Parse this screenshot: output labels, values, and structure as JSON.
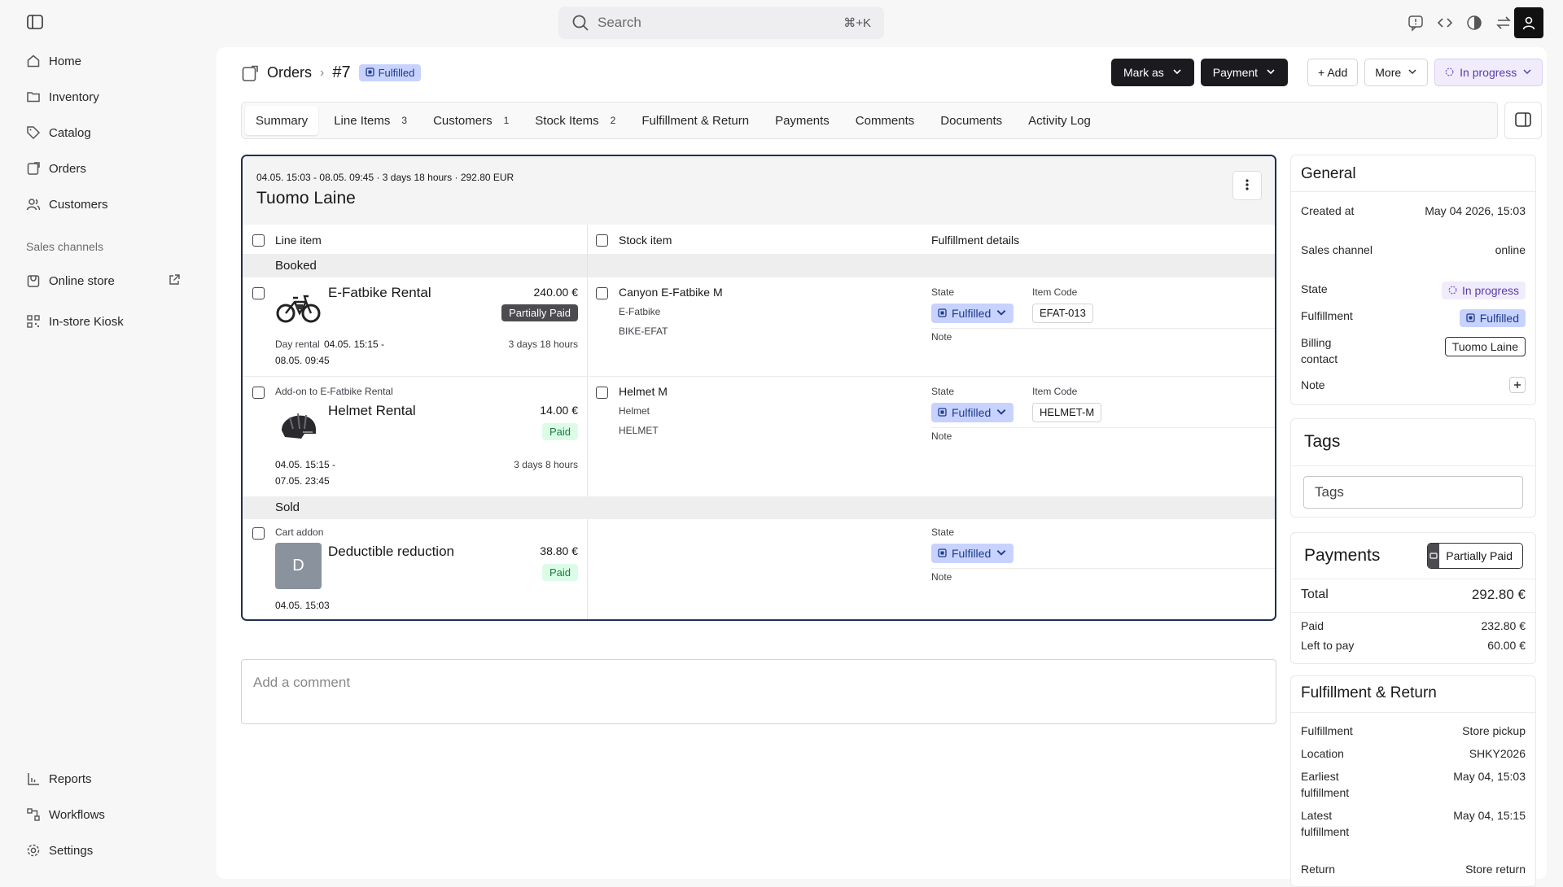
{
  "topbar": {
    "search_placeholder": "Search",
    "search_shortcut": "⌘+K"
  },
  "sidebar": {
    "items": [
      {
        "label": "Home",
        "icon": "home-icon"
      },
      {
        "label": "Inventory",
        "icon": "folder-icon"
      },
      {
        "label": "Catalog",
        "icon": "tag-icon"
      },
      {
        "label": "Orders",
        "icon": "orders-icon"
      },
      {
        "label": "Customers",
        "icon": "users-icon"
      }
    ],
    "channels_heading": "Sales channels",
    "channels": [
      {
        "label": "Online store"
      },
      {
        "label": "In-store Kiosk"
      }
    ],
    "bottom": [
      {
        "label": "Reports"
      },
      {
        "label": "Workflows"
      },
      {
        "label": "Settings"
      }
    ]
  },
  "header": {
    "breadcrumb": "Orders",
    "order_number": "#7",
    "status_badge": "Fulfilled",
    "mark_as": "Mark as",
    "payment": "Payment",
    "add": "+ Add",
    "more": "More",
    "progress": "In progress"
  },
  "tabs": [
    {
      "label": "Summary",
      "count": ""
    },
    {
      "label": "Line Items",
      "count": "3"
    },
    {
      "label": "Customers",
      "count": "1"
    },
    {
      "label": "Stock Items",
      "count": "2"
    },
    {
      "label": "Fulfillment & Return",
      "count": ""
    },
    {
      "label": "Payments",
      "count": ""
    },
    {
      "label": "Comments",
      "count": ""
    },
    {
      "label": "Documents",
      "count": ""
    },
    {
      "label": "Activity Log",
      "count": ""
    }
  ],
  "order": {
    "meta": "04.05. 15:03 - 08.05. 09:45 · 3 days 18 hours · 292.80 EUR",
    "customer": "Tuomo Laine",
    "col_line_item": "Line item",
    "col_stock_item": "Stock item",
    "col_fulfillment": "Fulfillment details",
    "sec_booked": "Booked",
    "sec_sold": "Sold",
    "state_label": "State",
    "item_code_label": "Item Code",
    "note_label": "Note",
    "rows": [
      {
        "name": "E-Fatbike Rental",
        "price": "240.00 €",
        "pay": "Partially Paid",
        "date_prefix": "Day rental",
        "date1": "04.05. 15:15 -",
        "date2": "08.05. 09:45",
        "duration": "3 days 18 hours",
        "stock_name": "Canyon E-Fatbike M",
        "stock_type": "E-Fatbike",
        "stock_sku": "BIKE-EFAT",
        "state": "Fulfilled",
        "code": "EFAT-013"
      },
      {
        "parent": "Add-on to E-Fatbike Rental",
        "name": "Helmet Rental",
        "price": "14.00 €",
        "pay": "Paid",
        "date1": "04.05. 15:15 -",
        "date2": "07.05. 23:45",
        "duration": "3 days 8 hours",
        "stock_name": "Helmet M",
        "stock_type": "Helmet",
        "stock_sku": "HELMET",
        "state": "Fulfilled",
        "code": "HELMET-M"
      },
      {
        "parent": "Cart addon",
        "name": "Deductible reduction",
        "avatar": "D",
        "price": "38.80 €",
        "pay": "Paid",
        "date1": "04.05. 15:03",
        "state": "Fulfilled"
      }
    ]
  },
  "comment_placeholder": "Add a comment",
  "general": {
    "title": "General",
    "created_label": "Created at",
    "created_value": "May 04 2026, 15:03",
    "channel_label": "Sales channel",
    "channel_value": "online",
    "state_label": "State",
    "state_value": "In progress",
    "fulfillment_label": "Fulfillment",
    "fulfillment_value": "Fulfilled",
    "billing_label": "Billing contact",
    "billing_value": "Tuomo Laine",
    "note_label": "Note"
  },
  "tags": {
    "title": "Tags",
    "placeholder": "Tags"
  },
  "payments": {
    "title": "Payments",
    "badge": "Partially Paid",
    "total_label": "Total",
    "total_value": "292.80 €",
    "paid_label": "Paid",
    "paid_value": "232.80 €",
    "left_label": "Left to pay",
    "left_value": "60.00 €"
  },
  "fr": {
    "title": "Fulfillment & Return",
    "fulfillment_label": "Fulfillment",
    "fulfillment_value": "Store pickup",
    "location_label": "Location",
    "location_value": "SHKY2026",
    "earliest_label": "Earliest fulfillment",
    "earliest_value": "May 04, 15:03",
    "latest_label": "Latest fulfillment",
    "latest_value": "May 04, 15:15",
    "return_label": "Return",
    "return_value": "Store return"
  }
}
